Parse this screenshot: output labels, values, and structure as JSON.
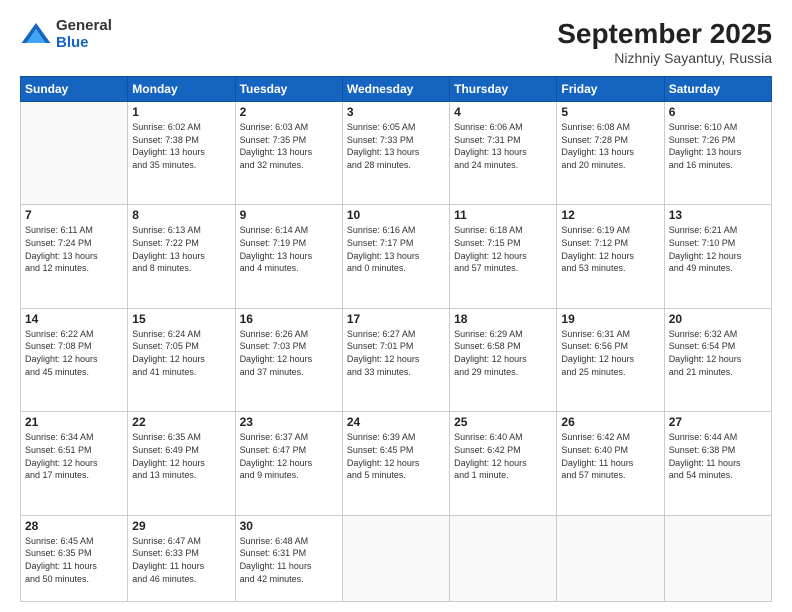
{
  "header": {
    "logo_general": "General",
    "logo_blue": "Blue",
    "month_title": "September 2025",
    "location": "Nizhniy Sayantuy, Russia"
  },
  "days_of_week": [
    "Sunday",
    "Monday",
    "Tuesday",
    "Wednesday",
    "Thursday",
    "Friday",
    "Saturday"
  ],
  "weeks": [
    [
      {
        "num": "",
        "info": ""
      },
      {
        "num": "1",
        "info": "Sunrise: 6:02 AM\nSunset: 7:38 PM\nDaylight: 13 hours\nand 35 minutes."
      },
      {
        "num": "2",
        "info": "Sunrise: 6:03 AM\nSunset: 7:35 PM\nDaylight: 13 hours\nand 32 minutes."
      },
      {
        "num": "3",
        "info": "Sunrise: 6:05 AM\nSunset: 7:33 PM\nDaylight: 13 hours\nand 28 minutes."
      },
      {
        "num": "4",
        "info": "Sunrise: 6:06 AM\nSunset: 7:31 PM\nDaylight: 13 hours\nand 24 minutes."
      },
      {
        "num": "5",
        "info": "Sunrise: 6:08 AM\nSunset: 7:28 PM\nDaylight: 13 hours\nand 20 minutes."
      },
      {
        "num": "6",
        "info": "Sunrise: 6:10 AM\nSunset: 7:26 PM\nDaylight: 13 hours\nand 16 minutes."
      }
    ],
    [
      {
        "num": "7",
        "info": "Sunrise: 6:11 AM\nSunset: 7:24 PM\nDaylight: 13 hours\nand 12 minutes."
      },
      {
        "num": "8",
        "info": "Sunrise: 6:13 AM\nSunset: 7:22 PM\nDaylight: 13 hours\nand 8 minutes."
      },
      {
        "num": "9",
        "info": "Sunrise: 6:14 AM\nSunset: 7:19 PM\nDaylight: 13 hours\nand 4 minutes."
      },
      {
        "num": "10",
        "info": "Sunrise: 6:16 AM\nSunset: 7:17 PM\nDaylight: 13 hours\nand 0 minutes."
      },
      {
        "num": "11",
        "info": "Sunrise: 6:18 AM\nSunset: 7:15 PM\nDaylight: 12 hours\nand 57 minutes."
      },
      {
        "num": "12",
        "info": "Sunrise: 6:19 AM\nSunset: 7:12 PM\nDaylight: 12 hours\nand 53 minutes."
      },
      {
        "num": "13",
        "info": "Sunrise: 6:21 AM\nSunset: 7:10 PM\nDaylight: 12 hours\nand 49 minutes."
      }
    ],
    [
      {
        "num": "14",
        "info": "Sunrise: 6:22 AM\nSunset: 7:08 PM\nDaylight: 12 hours\nand 45 minutes."
      },
      {
        "num": "15",
        "info": "Sunrise: 6:24 AM\nSunset: 7:05 PM\nDaylight: 12 hours\nand 41 minutes."
      },
      {
        "num": "16",
        "info": "Sunrise: 6:26 AM\nSunset: 7:03 PM\nDaylight: 12 hours\nand 37 minutes."
      },
      {
        "num": "17",
        "info": "Sunrise: 6:27 AM\nSunset: 7:01 PM\nDaylight: 12 hours\nand 33 minutes."
      },
      {
        "num": "18",
        "info": "Sunrise: 6:29 AM\nSunset: 6:58 PM\nDaylight: 12 hours\nand 29 minutes."
      },
      {
        "num": "19",
        "info": "Sunrise: 6:31 AM\nSunset: 6:56 PM\nDaylight: 12 hours\nand 25 minutes."
      },
      {
        "num": "20",
        "info": "Sunrise: 6:32 AM\nSunset: 6:54 PM\nDaylight: 12 hours\nand 21 minutes."
      }
    ],
    [
      {
        "num": "21",
        "info": "Sunrise: 6:34 AM\nSunset: 6:51 PM\nDaylight: 12 hours\nand 17 minutes."
      },
      {
        "num": "22",
        "info": "Sunrise: 6:35 AM\nSunset: 6:49 PM\nDaylight: 12 hours\nand 13 minutes."
      },
      {
        "num": "23",
        "info": "Sunrise: 6:37 AM\nSunset: 6:47 PM\nDaylight: 12 hours\nand 9 minutes."
      },
      {
        "num": "24",
        "info": "Sunrise: 6:39 AM\nSunset: 6:45 PM\nDaylight: 12 hours\nand 5 minutes."
      },
      {
        "num": "25",
        "info": "Sunrise: 6:40 AM\nSunset: 6:42 PM\nDaylight: 12 hours\nand 1 minute."
      },
      {
        "num": "26",
        "info": "Sunrise: 6:42 AM\nSunset: 6:40 PM\nDaylight: 11 hours\nand 57 minutes."
      },
      {
        "num": "27",
        "info": "Sunrise: 6:44 AM\nSunset: 6:38 PM\nDaylight: 11 hours\nand 54 minutes."
      }
    ],
    [
      {
        "num": "28",
        "info": "Sunrise: 6:45 AM\nSunset: 6:35 PM\nDaylight: 11 hours\nand 50 minutes."
      },
      {
        "num": "29",
        "info": "Sunrise: 6:47 AM\nSunset: 6:33 PM\nDaylight: 11 hours\nand 46 minutes."
      },
      {
        "num": "30",
        "info": "Sunrise: 6:48 AM\nSunset: 6:31 PM\nDaylight: 11 hours\nand 42 minutes."
      },
      {
        "num": "",
        "info": ""
      },
      {
        "num": "",
        "info": ""
      },
      {
        "num": "",
        "info": ""
      },
      {
        "num": "",
        "info": ""
      }
    ]
  ]
}
